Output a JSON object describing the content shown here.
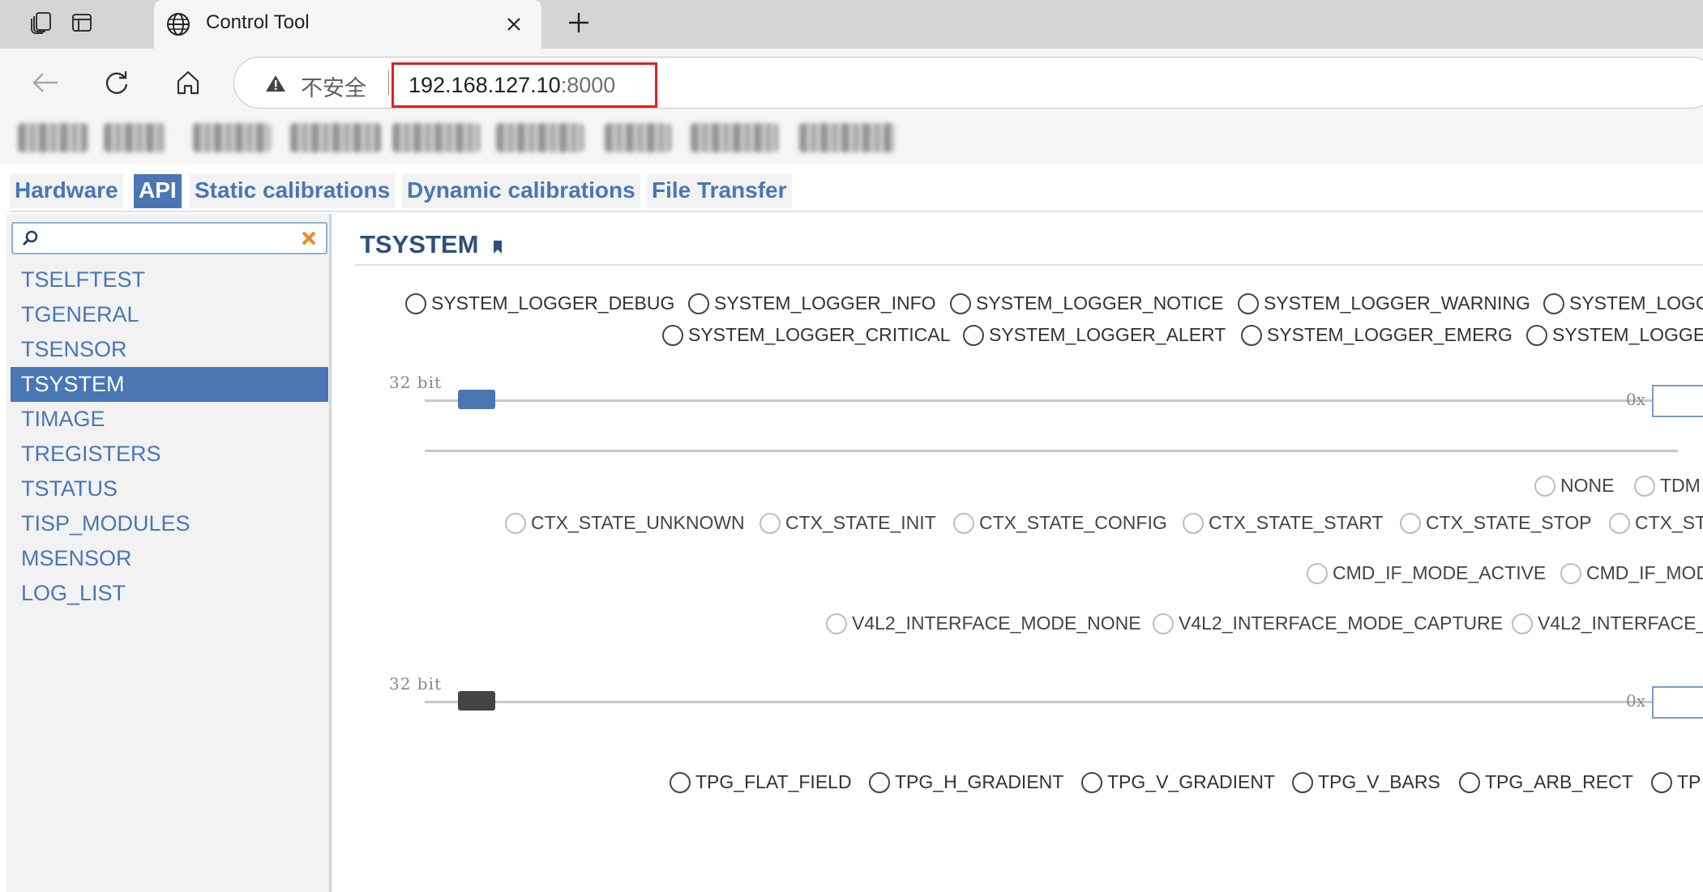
{
  "browser": {
    "tab_title": "Control Tool",
    "security_label": "不安全",
    "url_host": "192.168.127.10",
    "url_port": ":8000"
  },
  "nav": {
    "tabs": [
      {
        "label": "Hardware",
        "active": false
      },
      {
        "label": "API",
        "active": true
      },
      {
        "label": "Static calibrations",
        "active": false
      },
      {
        "label": "Dynamic calibrations",
        "active": false
      },
      {
        "label": "File Transfer",
        "active": false
      }
    ]
  },
  "sidebar": {
    "search_value": "",
    "items": [
      {
        "label": "TSELFTEST"
      },
      {
        "label": "TGENERAL"
      },
      {
        "label": "TSENSOR"
      },
      {
        "label": "TSYSTEM",
        "active": true
      },
      {
        "label": "TIMAGE"
      },
      {
        "label": "TREGISTERS"
      },
      {
        "label": "TSTATUS"
      },
      {
        "label": "TISP_MODULES"
      },
      {
        "label": "MSENSOR"
      },
      {
        "label": "LOG_LIST"
      }
    ]
  },
  "content": {
    "title": "TSYSTEM",
    "logger_row1": [
      "SYSTEM_LOGGER_DEBUG",
      "SYSTEM_LOGGER_INFO",
      "SYSTEM_LOGGER_NOTICE",
      "SYSTEM_LOGGER_WARNING",
      "SYSTEM_LOGG"
    ],
    "logger_row2": [
      "SYSTEM_LOGGER_CRITICAL",
      "SYSTEM_LOGGER_ALERT",
      "SYSTEM_LOGGER_EMERG",
      "SYSTEM_LOGGEI"
    ],
    "slider1": {
      "bit_label": "32 bit",
      "hex_prefix": "0x",
      "value": 0
    },
    "mode_options": [
      "NONE",
      "TDM"
    ],
    "ctx_states": [
      "CTX_STATE_UNKNOWN",
      "CTX_STATE_INIT",
      "CTX_STATE_CONFIG",
      "CTX_STATE_START",
      "CTX_STATE_STOP",
      "CTX_ST"
    ],
    "cmd_modes": [
      "CMD_IF_MODE_ACTIVE",
      "CMD_IF_MOD"
    ],
    "v4l2_modes": [
      "V4L2_INTERFACE_MODE_NONE",
      "V4L2_INTERFACE_MODE_CAPTURE",
      "V4L2_INTERFACE_"
    ],
    "slider2": {
      "bit_label": "32 bit",
      "hex_prefix": "0x",
      "value": 0
    },
    "tpg_patterns": [
      "TPG_FLAT_FIELD",
      "TPG_H_GRADIENT",
      "TPG_V_GRADIENT",
      "TPG_V_BARS",
      "TPG_ARB_RECT",
      "TP"
    ]
  },
  "colors": {
    "accent": "#4a77b4",
    "url_highlight": "#e0211d",
    "slider1_handle": "#4a77b4",
    "slider2_handle": "#444444"
  },
  "icons": [
    "workspaces-icon",
    "tab-actions-icon",
    "globe-icon",
    "close-icon",
    "plus-icon",
    "back-icon",
    "reload-icon",
    "home-icon",
    "warning-icon",
    "search-icon",
    "clear-icon",
    "bookmark-icon"
  ]
}
